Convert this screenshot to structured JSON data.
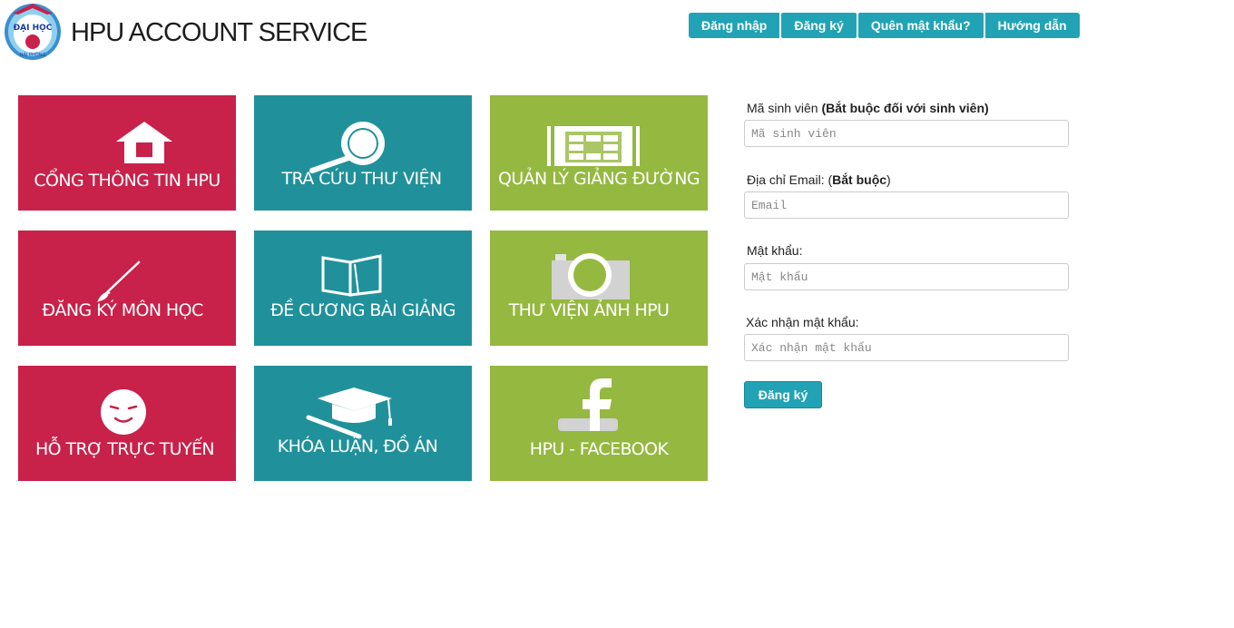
{
  "header": {
    "title": "HPU ACCOUNT SERVICE",
    "logo_text_top": "ĐẠI HỌC",
    "logo_text_bottom": "HẢI PHÒNG"
  },
  "nav": {
    "login": "Đăng nhập",
    "register": "Đăng ký",
    "forgot": "Quên mật khẩu?",
    "guide": "Hướng dẫn"
  },
  "tiles": [
    {
      "label": "CỔNG THÔNG TIN HPU",
      "icon": "home-icon",
      "color": "#c8214a"
    },
    {
      "label": "TRA CỨU THƯ VIỆN",
      "icon": "magnifier-icon",
      "color": "#20919b"
    },
    {
      "label": "QUẢN LÝ GIẢNG ĐƯỜNG",
      "icon": "building-icon",
      "color": "#95b840"
    },
    {
      "label": "ĐĂNG KÝ MÔN HỌC",
      "icon": "brush-icon",
      "color": "#c8214a"
    },
    {
      "label": "ĐỀ CƯƠNG BÀI GIẢNG",
      "icon": "book-icon",
      "color": "#20919b"
    },
    {
      "label": "THƯ VIỆN ẢNH HPU",
      "icon": "camera-icon",
      "color": "#95b840"
    },
    {
      "label": "HỖ TRỢ TRỰC TUYẾN",
      "icon": "smiley-icon",
      "color": "#c8214a"
    },
    {
      "label": "KHÓA LUẬN, ĐỒ ÁN",
      "icon": "graduation-cap-icon",
      "color": "#20919b"
    },
    {
      "label": "HPU - FACEBOOK",
      "icon": "facebook-icon",
      "color": "#95b840"
    }
  ],
  "form": {
    "student_id_label": "Mã sinh viên ",
    "student_id_required": "(Bắt buộc đối với sinh viên)",
    "student_id_placeholder": "Mã sinh viên",
    "email_label": "Địa chỉ Email: (",
    "email_required": "Bắt buộc",
    "email_label_end": ")",
    "email_placeholder": "Email",
    "password_label": "Mật khẩu:",
    "password_placeholder": "Mật khẩu",
    "confirm_label": "Xác nhận mật khẩu:",
    "confirm_placeholder": "Xác nhận mật khẩu",
    "submit": "Đăng ký"
  }
}
